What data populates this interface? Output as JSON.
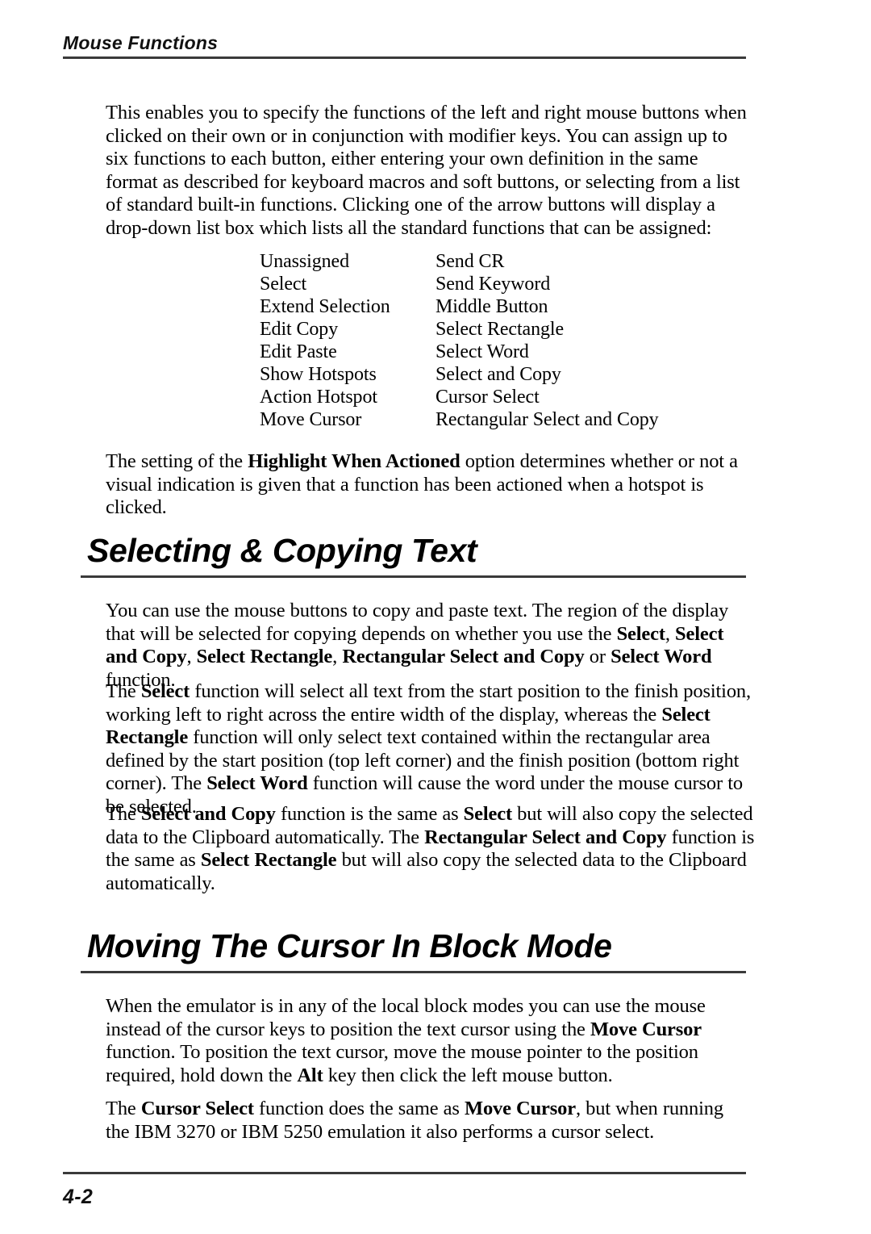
{
  "header": {
    "running_title": "Mouse Functions"
  },
  "intro": {
    "paragraph": "This enables you to specify the functions of the left and right mouse buttons when clicked on their own or in conjunction with modifier keys. You can assign up to six functions to each button, either entering your own definition in the same format as described for keyboard macros and soft buttons, or selecting from a list of standard built-in functions. Clicking one of the arrow buttons will display a drop-down list box which lists all the standard functions that can be assigned:"
  },
  "function_list": {
    "rows": [
      {
        "left": "Unassigned",
        "right": "Send CR"
      },
      {
        "left": "Select",
        "right": "Send Keyword"
      },
      {
        "left": "Extend Selection",
        "right": "Middle Button"
      },
      {
        "left": "Edit Copy",
        "right": "Select Rectangle"
      },
      {
        "left": "Edit Paste",
        "right": "Select Word"
      },
      {
        "left": "Show Hotspots",
        "right": "Select and Copy"
      },
      {
        "left": "Action Hotspot",
        "right": "Cursor Select"
      },
      {
        "left": "Move Cursor",
        "right": "Rectangular Select and Copy"
      }
    ]
  },
  "highlight_note": {
    "part1": "The setting of the ",
    "bold1": "Highlight When Actioned",
    "part2": " option determines whether or not a visual indication is given that a function has been actioned when a hotspot is clicked."
  },
  "section_selecting": {
    "heading": "Selecting & Copying Text",
    "p1": {
      "part1": "You can use the mouse buttons to copy and paste text. The region of the display that will be selected for copying depends on whether you use the ",
      "bold1": "Select",
      "part2": ", ",
      "bold2": "Select and Copy",
      "part3": ", ",
      "bold3": "Select Rectangle",
      "part4": ", ",
      "bold4": "Rectangular Select and Copy",
      "part5": " or ",
      "bold5": "Select Word",
      "part6": " function."
    },
    "p2": {
      "part1": "The ",
      "bold1": "Select",
      "part2": " function will select all text from the start position to the finish position, working left to right across the entire width of the display, whereas the ",
      "bold2": "Select Rectangle",
      "part3": " function will only select text contained within the rectangular area defined by the start position (top left corner) and the finish position (bottom right corner). The ",
      "bold3": "Select Word",
      "part4": " function will cause the word under the mouse cursor to be selected."
    },
    "p3": {
      "part1": "The ",
      "bold1": "Select and Copy",
      "part2": " function is the same as ",
      "bold2": "Select",
      "part3": " but will also copy the selected data to the Clipboard automatically. The ",
      "bold3": "Rectangular Select and Copy",
      "part4": " function is the same as ",
      "bold4": "Select Rectangle",
      "part5": " but will also copy the selected data to the Clipboard automatically."
    }
  },
  "section_moving": {
    "heading": "Moving The Cursor In Block Mode",
    "p1": {
      "part1": "When the emulator is in any of the local block modes you can use the mouse instead of the cursor keys to position the text cursor using the ",
      "bold1": "Move Cursor",
      "part2": " function. To position the text cursor, move the mouse pointer to the position required, hold down the ",
      "bold2": "Alt",
      "part3": " key then click the left mouse button."
    },
    "p2": {
      "part1": "The ",
      "bold1": "Cursor Select",
      "part2": " function does the same as ",
      "bold2": "Move Cursor",
      "part3": ", but when running the IBM 3270 or IBM 5250 emulation it also performs a cursor select."
    }
  },
  "footer": {
    "page_number": "4-2"
  }
}
